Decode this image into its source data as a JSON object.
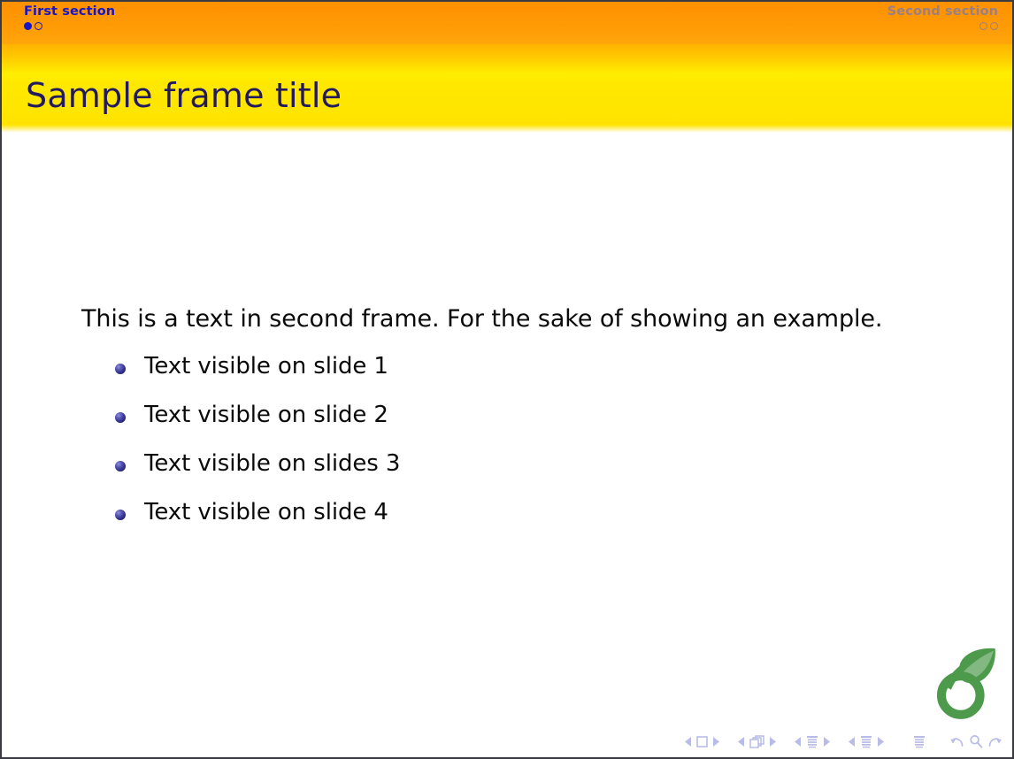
{
  "slide": {
    "header": {
      "sections": [
        {
          "label": "First section",
          "state": "active",
          "color": "#1616c8",
          "dots": [
            "filled",
            "hollow"
          ]
        },
        {
          "label": "Second section",
          "state": "inactive",
          "color": "#9a7f84",
          "dots": [
            "hollow",
            "hollow"
          ]
        }
      ],
      "bar_color_top": "#ff9000",
      "bar_color_bottom": "#ffa60a"
    },
    "title": {
      "text": "Sample frame title",
      "color": "#231a5e",
      "background_top": "#ffb400",
      "background_bottom": "#ffe400"
    },
    "content": {
      "intro": "This is a text in second frame.  For the sake of showing an example.",
      "bullets": [
        {
          "text": "Text visible on slide 1"
        },
        {
          "text": "Text visible on slide 2"
        },
        {
          "text": "Text visible on slides 3"
        },
        {
          "text": "Text visible on slide 4"
        }
      ],
      "bullet_color": "#32328f"
    },
    "logo": {
      "name": "overleaf-logo",
      "color": "#4d9a4d"
    },
    "navigation_symbols": {
      "color": "#b9bce6",
      "groups": [
        {
          "name": "slide-navigation",
          "icon": "square",
          "prev": "◀",
          "next": "▶"
        },
        {
          "name": "frame-navigation",
          "icon": "stacked-squares",
          "prev": "◀",
          "next": "▶"
        },
        {
          "name": "subsection-navigation",
          "icon": "lines",
          "prev": "◀",
          "next": "▶"
        },
        {
          "name": "section-navigation",
          "icon": "lines",
          "prev": "◀",
          "next": "▶"
        },
        {
          "name": "presentation-navigation",
          "icon": "lines"
        },
        {
          "name": "back-button",
          "icon": "back-arrow"
        },
        {
          "name": "search-button",
          "icon": "magnifier"
        },
        {
          "name": "forward-button",
          "icon": "forward-arrow"
        }
      ]
    }
  }
}
